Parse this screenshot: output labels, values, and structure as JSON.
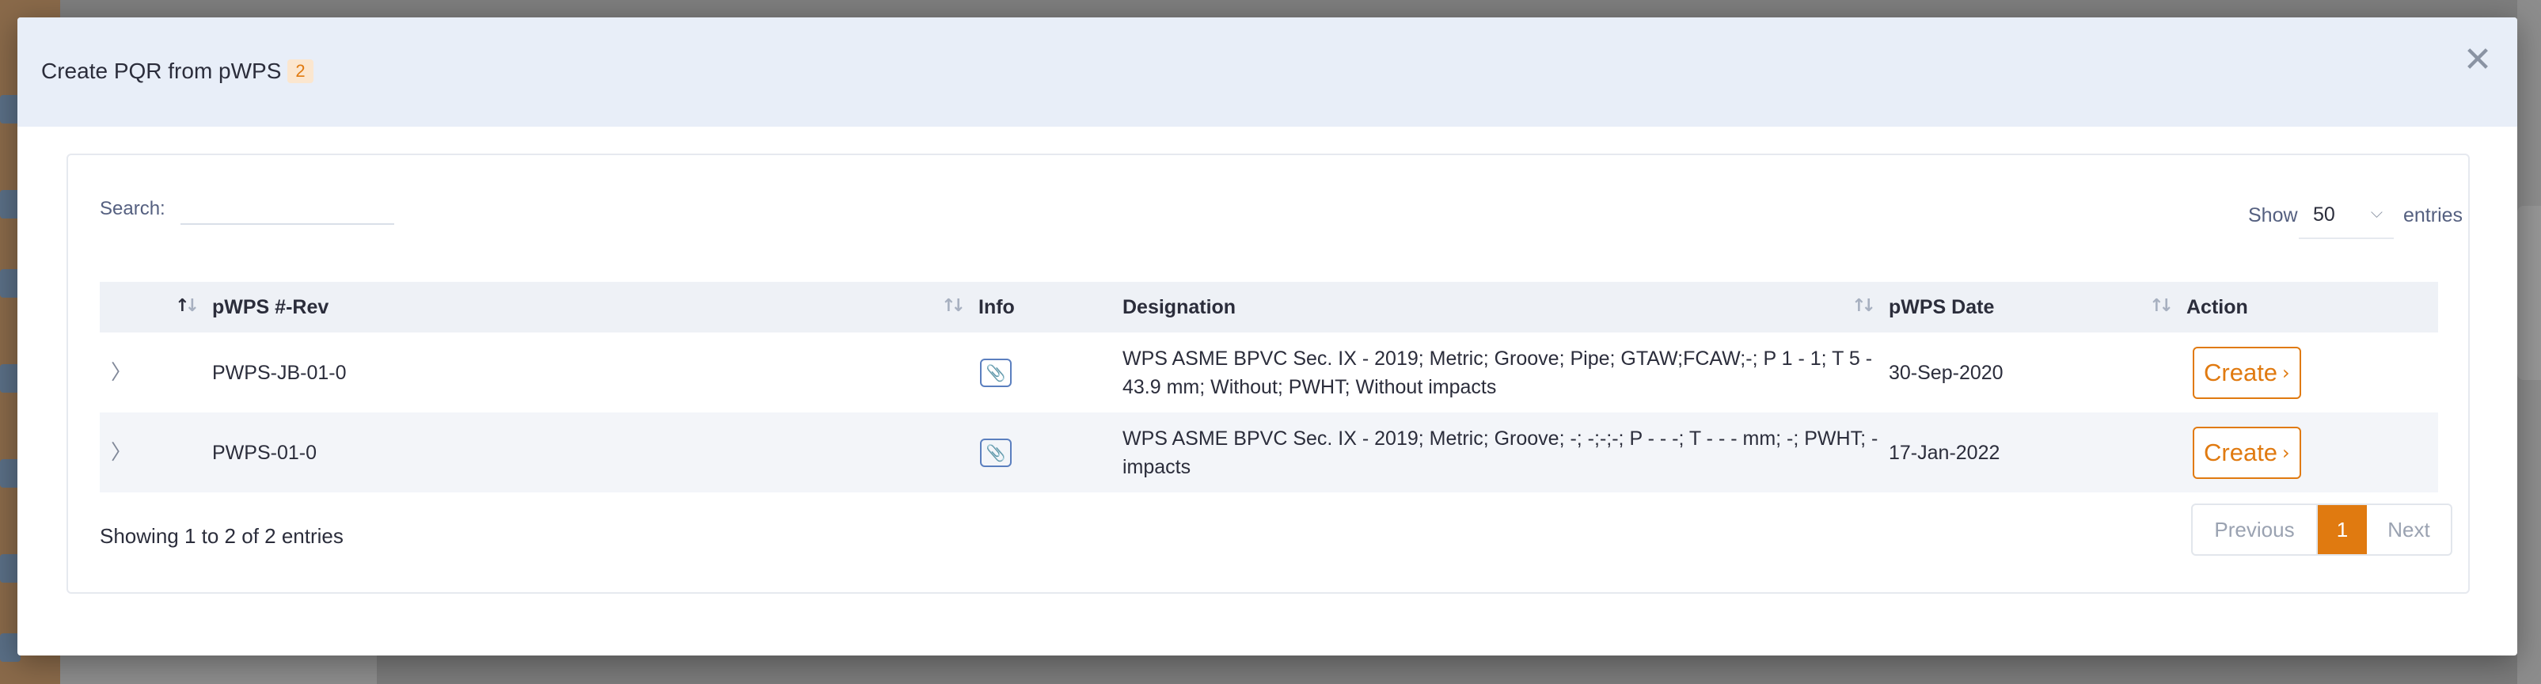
{
  "modal": {
    "title": "Create PQR from pWPS",
    "count": "2"
  },
  "search": {
    "label": "Search:",
    "value": ""
  },
  "length_menu": {
    "show_label": "Show",
    "selected": "50",
    "entries_label": "entries"
  },
  "table": {
    "columns": [
      "",
      "pWPS #-Rev",
      "Info",
      "Designation",
      "pWPS Date",
      "Action"
    ],
    "rows": [
      {
        "pwps_rev": "PWPS-JB-01-0",
        "designation": "WPS ASME BPVC Sec. IX - 2019; Metric; Groove; Pipe; GTAW;FCAW;-; P 1 - 1; T 5 - 43.9 mm; Without; PWHT; Without impacts",
        "date": "30-Sep-2020",
        "action": "Create"
      },
      {
        "pwps_rev": "PWPS-01-0",
        "designation": "WPS ASME BPVC Sec. IX - 2019; Metric; Groove; -; -;-;-; P - - -; T - - - mm; -; PWHT; - impacts",
        "date": "17-Jan-2022",
        "action": "Create"
      }
    ]
  },
  "footer": {
    "info": "Showing 1 to 2 of 2 entries",
    "pagination": {
      "previous": "Previous",
      "current": "1",
      "next": "Next"
    }
  },
  "colors": {
    "accent": "#e07a10",
    "header_bg": "#e8eef8",
    "info_icon": "#3f66b0"
  },
  "icons": {
    "close": "close-icon",
    "expand": "chevron-right-icon",
    "info": "paperclip-icon",
    "create_arrow": "chevron-right-icon"
  }
}
